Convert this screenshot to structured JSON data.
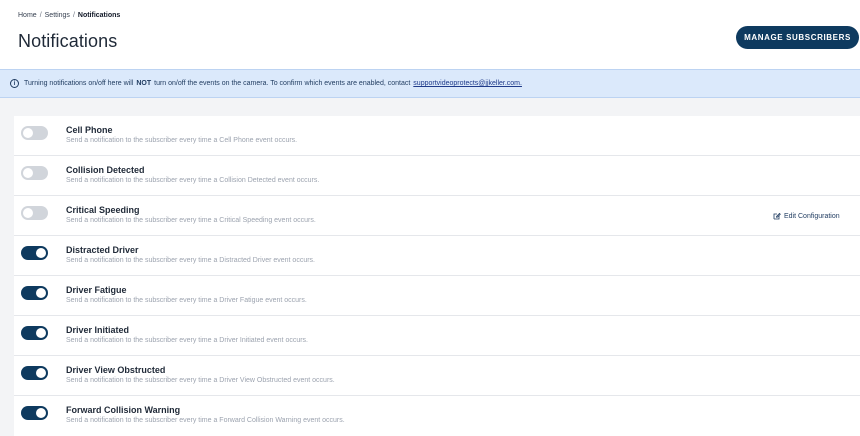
{
  "breadcrumb": {
    "home": "Home",
    "sep1": "/",
    "settings": "Settings",
    "sep2": "/",
    "current": "Notifications"
  },
  "page": {
    "title": "Notifications"
  },
  "header": {
    "manage_button": "MANAGE SUBSCRIBERS"
  },
  "banner": {
    "icon": "info-icon",
    "text_before": "Turning notifications on/off here will",
    "emphasis": "NOT",
    "text_after": "turn on/off the events on the camera. To confirm which events are enabled, contact",
    "link": "supportvideoprotects@jjkeller.com."
  },
  "colors": {
    "accent": "#0e3a5f",
    "banner_bg": "#dbe9fb",
    "toggle_off": "#d1d5db"
  },
  "notifications": [
    {
      "title": "Cell Phone",
      "desc": "Send a notification to the subscriber every time a Cell Phone event occurs.",
      "enabled": false
    },
    {
      "title": "Collision Detected",
      "desc": "Send a notification to the subscriber every time a Collision Detected event occurs.",
      "enabled": false
    },
    {
      "title": "Critical Speeding",
      "desc": "Send a notification to the subscriber every time a Critical Speeding event occurs.",
      "enabled": false,
      "action": "Edit Configuration"
    },
    {
      "title": "Distracted Driver",
      "desc": "Send a notification to the subscriber every time a Distracted Driver event occurs.",
      "enabled": true
    },
    {
      "title": "Driver Fatigue",
      "desc": "Send a notification to the subscriber every time a Driver Fatigue event occurs.",
      "enabled": true
    },
    {
      "title": "Driver Initiated",
      "desc": "Send a notification to the subscriber every time a Driver Initiated event occurs.",
      "enabled": true
    },
    {
      "title": "Driver View Obstructed",
      "desc": "Send a notification to the subscriber every time a Driver View Obstructed event occurs.",
      "enabled": true
    },
    {
      "title": "Forward Collision Warning",
      "desc": "Send a notification to the subscriber every time a Forward Collision Warning event occurs.",
      "enabled": true
    }
  ]
}
